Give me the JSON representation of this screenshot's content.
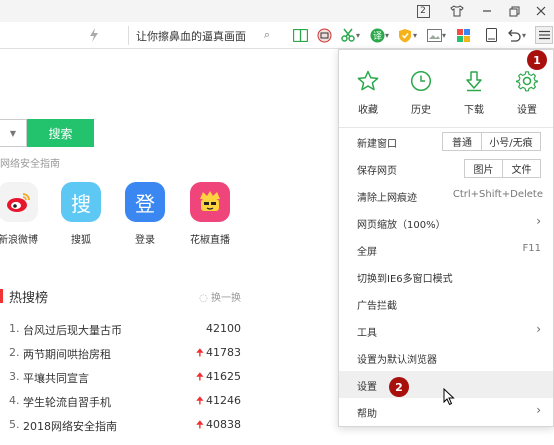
{
  "titlebar": {
    "tab_count": "2",
    "icons": [
      "tab-count-icon",
      "shirt-icon",
      "minimize-icon",
      "restore-icon",
      "close-icon"
    ]
  },
  "toolbar": {
    "search_text": "让你擦鼻血的逼真画面",
    "icons": [
      "lightning-icon",
      "search-icon",
      "book-icon",
      "screenshot-icon",
      "scissors-icon",
      "translate-icon",
      "shield-icon",
      "image-icon",
      "apps-icon",
      "reader-icon",
      "undo-icon",
      "menu-icon"
    ]
  },
  "page": {
    "search_button": "搜索",
    "safety_text": "网络安全指南",
    "shortcuts": [
      {
        "label": "新浪微博",
        "icon": "weibo-icon",
        "color": "#f3f3f3",
        "glyph": ""
      },
      {
        "label": "搜狐",
        "icon": "sohu-icon",
        "color": "#5ec8f5",
        "glyph": "搜"
      },
      {
        "label": "登录",
        "icon": "login-icon",
        "color": "#3b87f2",
        "glyph": "登"
      },
      {
        "label": "花椒直播",
        "icon": "huajiao-icon",
        "color": "#f0457a",
        "glyph": ""
      }
    ],
    "hot": {
      "title": "热搜榜",
      "refresh": "换一换",
      "rows": [
        {
          "rank": "1.",
          "text": "台风过后现大量古币",
          "count": "42100",
          "up": ""
        },
        {
          "rank": "2.",
          "text": "两节期间哄抬房租",
          "count": "41783",
          "up": "🠉"
        },
        {
          "rank": "3.",
          "text": "平壤共同宣言",
          "count": "41625",
          "up": "🠉"
        },
        {
          "rank": "4.",
          "text": "学生轮流自習手机",
          "count": "41246",
          "up": "🠉"
        },
        {
          "rank": "5.",
          "text": "2018网络安全指南",
          "count": "40838",
          "up": "🠉"
        }
      ]
    }
  },
  "menu": {
    "quick": [
      {
        "label": "收藏",
        "icon": "star-icon"
      },
      {
        "label": "历史",
        "icon": "clock-icon"
      },
      {
        "label": "下载",
        "icon": "download-icon"
      },
      {
        "label": "设置",
        "icon": "gear-icon"
      }
    ],
    "new_window": "新建窗口",
    "new_window_normal": "普通",
    "new_window_incognito": "小号/无痕",
    "save_page": "保存网页",
    "save_image": "图片",
    "save_file": "文件",
    "clear_history": "清除上网痕迹",
    "clear_history_shortcut": "Ctrl+Shift+Delete",
    "zoom": "网页缩放（100%）",
    "fullscreen": "全屏",
    "fullscreen_shortcut": "F11",
    "ie6_mode": "切换到IE6多窗口模式",
    "adblock": "广告拦截",
    "tools": "工具",
    "set_default": "设置为默认浏览器",
    "settings": "设置",
    "help": "帮助"
  },
  "badges": {
    "one": "1",
    "two": "2"
  },
  "colors": {
    "accent_green": "#23c36d",
    "badge_red": "#a8100e",
    "hot_red": "#e33333"
  }
}
